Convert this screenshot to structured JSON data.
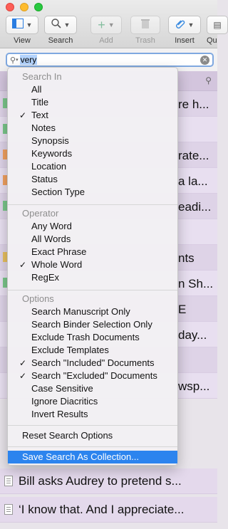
{
  "toolbar": {
    "buttons": [
      {
        "label": "View",
        "icon": "view-layout-icon",
        "enabled": true
      },
      {
        "label": "Search",
        "icon": "search-icon",
        "enabled": true
      },
      {
        "label": "Add",
        "icon": "plus-icon",
        "enabled": false
      },
      {
        "label": "Trash",
        "icon": "trash-icon",
        "enabled": false
      },
      {
        "label": "Insert",
        "icon": "paperclip-icon",
        "enabled": true
      },
      {
        "label": "Qu",
        "icon": "quick-ref-icon",
        "enabled": true
      }
    ]
  },
  "search": {
    "query": "very"
  },
  "binder_rows": [
    {
      "text": "re h...",
      "mark": "#7ac68a"
    },
    {
      "text": "",
      "mark": "#7ac68a"
    },
    {
      "text": "rate...",
      "mark": "#f0a060"
    },
    {
      "text": "a la...",
      "mark": "#f0a060"
    },
    {
      "text": "eadi...",
      "mark": "#7ac68a"
    },
    {
      "text": "",
      "mark": ""
    },
    {
      "text": "nts",
      "mark": "#e8c060"
    },
    {
      "text": "n Sh...",
      "mark": "#7ac68a"
    },
    {
      "text": "E",
      "mark": ""
    },
    {
      "text": "day...",
      "mark": ""
    },
    {
      "text": "",
      "mark": ""
    },
    {
      "text": "wsp...",
      "mark": ""
    }
  ],
  "doc_rows": [
    {
      "text": "Bill asks Audrey to pretend s..."
    },
    {
      "text": "‘I know that. And I appreciate..."
    }
  ],
  "menu": {
    "search_in": {
      "header": "Search In",
      "items": [
        {
          "label": "All",
          "checked": false
        },
        {
          "label": "Title",
          "checked": false
        },
        {
          "label": "Text",
          "checked": true
        },
        {
          "label": "Notes",
          "checked": false
        },
        {
          "label": "Synopsis",
          "checked": false
        },
        {
          "label": "Keywords",
          "checked": false
        },
        {
          "label": "Location",
          "checked": false
        },
        {
          "label": "Status",
          "checked": false
        },
        {
          "label": "Section Type",
          "checked": false
        }
      ]
    },
    "operator": {
      "header": "Operator",
      "items": [
        {
          "label": "Any Word",
          "checked": false
        },
        {
          "label": "All Words",
          "checked": false
        },
        {
          "label": "Exact Phrase",
          "checked": false
        },
        {
          "label": "Whole Word",
          "checked": true
        },
        {
          "label": "RegEx",
          "checked": false
        }
      ]
    },
    "options": {
      "header": "Options",
      "items": [
        {
          "label": "Search Manuscript Only",
          "checked": false
        },
        {
          "label": "Search Binder Selection Only",
          "checked": false
        },
        {
          "label": "Exclude Trash Documents",
          "checked": false
        },
        {
          "label": "Exclude Templates",
          "checked": false
        },
        {
          "label": "Search \"Included\" Documents",
          "checked": true
        },
        {
          "label": "Search \"Excluded\" Documents",
          "checked": true
        },
        {
          "label": "Case Sensitive",
          "checked": false
        },
        {
          "label": "Ignore Diacritics",
          "checked": false
        },
        {
          "label": "Invert Results",
          "checked": false
        }
      ]
    },
    "reset_label": "Reset Search Options",
    "save_label": "Save Search As Collection...",
    "check_glyph": "✓",
    "highlight_color": "#2c84ee"
  }
}
